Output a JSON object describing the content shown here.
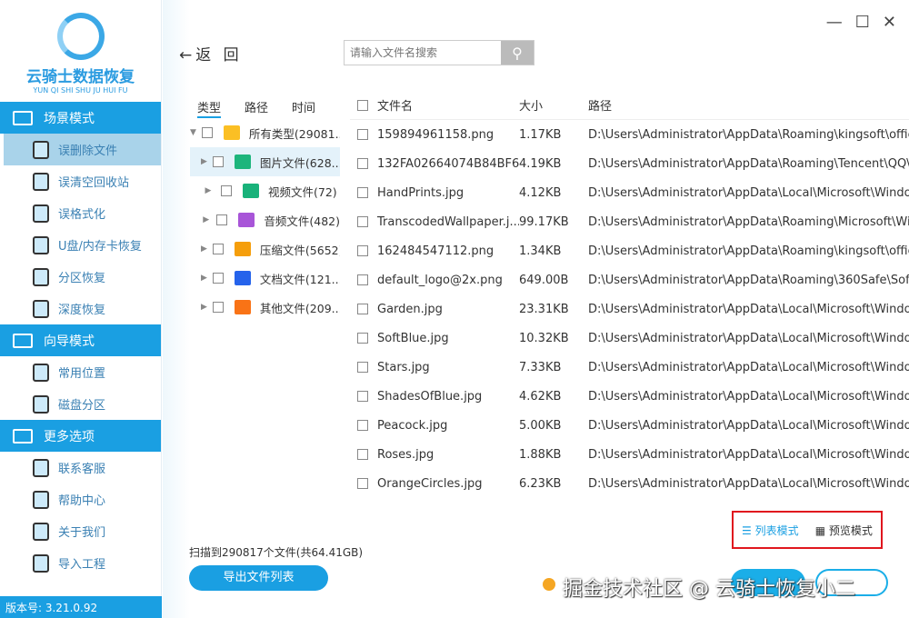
{
  "app": {
    "title": "云骑士数据恢复",
    "subtitle": "YUN QI SHI SHU JU HUI FU",
    "version": "版本号: 3.21.0.92"
  },
  "sidebar": {
    "sections": [
      {
        "label": "场景模式",
        "items": [
          "误删除文件",
          "误清空回收站",
          "误格式化",
          "U盘/内存卡恢复",
          "分区恢复",
          "深度恢复"
        ]
      },
      {
        "label": "向导模式",
        "items": [
          "常用位置",
          "磁盘分区"
        ]
      },
      {
        "label": "更多选项",
        "items": [
          "联系客服",
          "帮助中心",
          "关于我们",
          "导入工程"
        ]
      }
    ],
    "active": "误删除文件"
  },
  "header": {
    "back": "返 回",
    "search_placeholder": "请输入文件名搜索"
  },
  "tree": {
    "tabs": [
      "类型",
      "路径",
      "时间"
    ],
    "items": [
      {
        "label": "所有类型(29081...",
        "color": "#fbbf24"
      },
      {
        "label": "图片文件(628...",
        "color": "#1db57c"
      },
      {
        "label": "视频文件(72)",
        "color": "#19b27a"
      },
      {
        "label": "音频文件(482)",
        "color": "#a855d8"
      },
      {
        "label": "压缩文件(5652)",
        "color": "#f59e0b"
      },
      {
        "label": "文档文件(121...",
        "color": "#2563eb"
      },
      {
        "label": "其他文件(209...",
        "color": "#f97316"
      }
    ]
  },
  "list": {
    "headers": [
      "文件名",
      "大小",
      "路径"
    ],
    "rows": [
      [
        "159894961158.png",
        "1.17KB",
        "D:\\Users\\Administrator\\AppData\\Roaming\\kingsoft\\offic..."
      ],
      [
        "132FA02664074B84BF67...",
        "4.19KB",
        "D:\\Users\\Administrator\\AppData\\Roaming\\Tencent\\QQ\\..."
      ],
      [
        "HandPrints.jpg",
        "4.12KB",
        "D:\\Users\\Administrator\\AppData\\Local\\Microsoft\\Windo..."
      ],
      [
        "TranscodedWallpaper.j...",
        "99.17KB",
        "D:\\Users\\Administrator\\AppData\\Roaming\\Microsoft\\Wi..."
      ],
      [
        "162484547112.png",
        "1.34KB",
        "D:\\Users\\Administrator\\AppData\\Roaming\\kingsoft\\offic..."
      ],
      [
        "default_logo@2x.png",
        "649.00B",
        "D:\\Users\\Administrator\\AppData\\Roaming\\360Safe\\Soft..."
      ],
      [
        "Garden.jpg",
        "23.31KB",
        "D:\\Users\\Administrator\\AppData\\Local\\Microsoft\\Windo..."
      ],
      [
        "SoftBlue.jpg",
        "10.32KB",
        "D:\\Users\\Administrator\\AppData\\Local\\Microsoft\\Windo..."
      ],
      [
        "Stars.jpg",
        "7.33KB",
        "D:\\Users\\Administrator\\AppData\\Local\\Microsoft\\Windo..."
      ],
      [
        "ShadesOfBlue.jpg",
        "4.62KB",
        "D:\\Users\\Administrator\\AppData\\Local\\Microsoft\\Windo..."
      ],
      [
        "Peacock.jpg",
        "5.00KB",
        "D:\\Users\\Administrator\\AppData\\Local\\Microsoft\\Windo..."
      ],
      [
        "Roses.jpg",
        "1.88KB",
        "D:\\Users\\Administrator\\AppData\\Local\\Microsoft\\Windo..."
      ],
      [
        "OrangeCircles.jpg",
        "6.23KB",
        "D:\\Users\\Administrator\\AppData\\Local\\Microsoft\\Windo..."
      ]
    ]
  },
  "footer": {
    "scan_info": "扫描到290817个文件(共64.41GB)",
    "export": "导出文件列表",
    "list_mode": "列表模式",
    "preview_mode": "预览模式",
    "watermark": "掘金技术社区 @ 云骑士恢复小二"
  }
}
